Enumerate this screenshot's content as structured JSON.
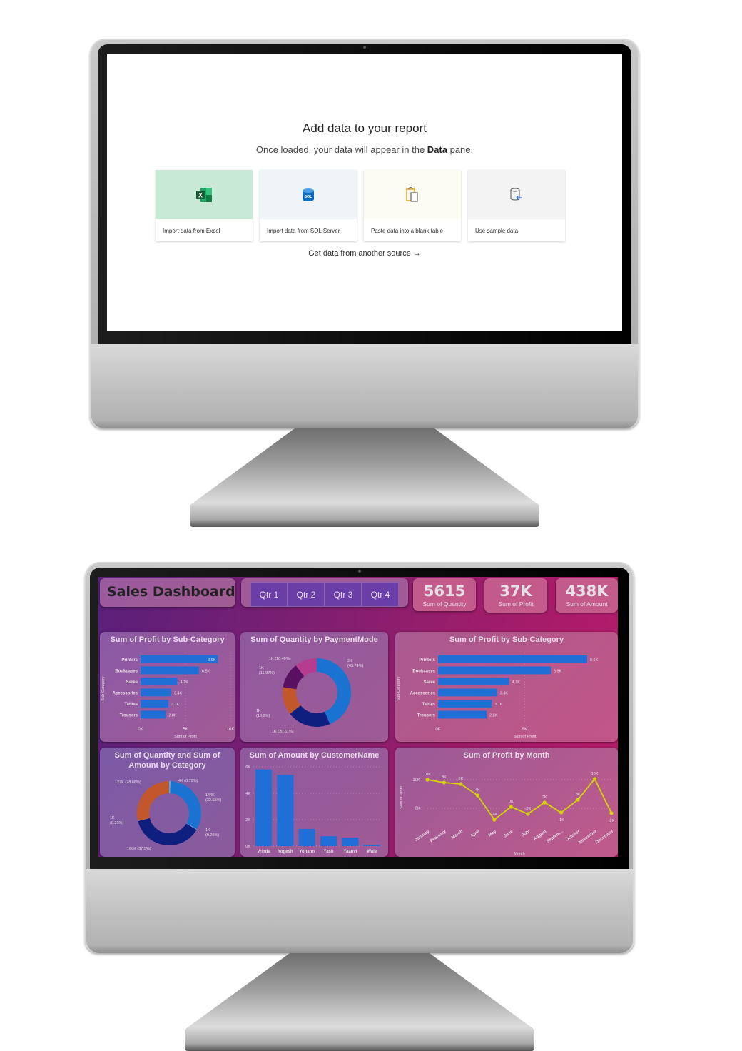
{
  "add_data": {
    "title": "Add data to your report",
    "subtitle_pre": "Once loaded, your data will appear in the ",
    "subtitle_bold": "Data",
    "subtitle_post": " pane.",
    "cards": [
      {
        "label": "Import data from Excel",
        "icon": "excel-icon",
        "bg": "#c7e9d6"
      },
      {
        "label": "Import data from SQL Server",
        "icon": "sql-database-icon",
        "bg": "#eff4f9"
      },
      {
        "label": "Paste data into a blank table",
        "icon": "clipboard-paste-icon",
        "bg": "#fcfbf4"
      },
      {
        "label": "Use sample data",
        "icon": "sample-database-icon",
        "bg": "#f3f3f3"
      }
    ],
    "more_link": "Get data from another source →"
  },
  "dashboard": {
    "title": "Sales Dashboard",
    "quarters": [
      "Qtr 1",
      "Qtr 2",
      "Qtr 3",
      "Qtr 4"
    ],
    "kpis": [
      {
        "value": "5615",
        "label": "Sum of Quantity"
      },
      {
        "value": "37K",
        "label": "Sum of Profit"
      },
      {
        "value": "438K",
        "label": "Sum of Amount"
      }
    ],
    "colors": {
      "bar": "#1f6fd6",
      "line": "#d4d400",
      "axis_text": "#e8dde8"
    }
  },
  "chart_data": [
    {
      "id": "profit_subcat_small",
      "type": "bar",
      "orientation": "horizontal",
      "title": "Sum of Profit by Sub-Category",
      "xlabel": "Sum of Profit",
      "ylabel": "Sub-Category",
      "categories": [
        "Printers",
        "Bookcases",
        "Saree",
        "Accessories",
        "Tables",
        "Trousers"
      ],
      "values": [
        8600,
        6500,
        4100,
        3400,
        3100,
        2800
      ],
      "data_labels": [
        "8.6K",
        "6.5K",
        "4.1K",
        "3.4K",
        "3.1K",
        "2.8K"
      ],
      "xticks": [
        "0K",
        "5K",
        "10K"
      ],
      "xlim": [
        0,
        10000
      ]
    },
    {
      "id": "qty_paymentmode",
      "type": "pie",
      "donut": true,
      "title": "Sum of Quantity by PaymentMode",
      "slices": [
        {
          "label": "2K (43.74%)",
          "value": 43.74,
          "color": "#1a73d1"
        },
        {
          "label": "1K (20.61%)",
          "value": 20.61,
          "color": "#0f1f80"
        },
        {
          "label": "1K (13.2%)",
          "value": 13.2,
          "color": "#c1572b"
        },
        {
          "label": "1K (11.97%)",
          "value": 11.97,
          "color": "#5a1060"
        },
        {
          "label": "1K (10.49%)",
          "value": 10.49,
          "color": "#b63c8f"
        }
      ]
    },
    {
      "id": "profit_subcat_large",
      "type": "bar",
      "orientation": "horizontal",
      "title": "Sum of Profit by Sub-Category",
      "xlabel": "Sum of Profit",
      "ylabel": "Sub-Category",
      "categories": [
        "Printers",
        "Bookcases",
        "Saree",
        "Accessories",
        "Tables",
        "Trousers"
      ],
      "values": [
        8600,
        6500,
        4100,
        3400,
        3100,
        2800
      ],
      "data_labels": [
        "8.6K",
        "6.5K",
        "4.1K",
        "3.4K",
        "3.1K",
        "2.8K"
      ],
      "xticks": [
        "0K",
        "5K"
      ],
      "xlim": [
        0,
        10000
      ]
    },
    {
      "id": "qty_amount_category",
      "type": "pie",
      "donut": true,
      "title": "Sum of Quantity and Sum of Amount by Category",
      "slices": [
        {
          "label": "4K (0.79%)",
          "value": 0.79,
          "color": "#5fa3e6"
        },
        {
          "label": "144K (32.55%)",
          "value": 32.55,
          "color": "#1a73d1"
        },
        {
          "label": "1K (0.26%)",
          "value": 0.26,
          "color": "#9bc0ea"
        },
        {
          "label": "166K (37.5%)",
          "value": 37.5,
          "color": "#0f1f80"
        },
        {
          "label": "1K (0.21%)",
          "value": 0.21,
          "color": "#e0a070"
        },
        {
          "label": "127K (28.68%)",
          "value": 28.68,
          "color": "#c1572b"
        }
      ]
    },
    {
      "id": "amount_customer",
      "type": "bar",
      "orientation": "vertical",
      "title": "Sum of Amount by CustomerName",
      "categories": [
        "Vrinda",
        "Yogesh",
        "Yohann",
        "Yash",
        "Yaanvi",
        "Wale"
      ],
      "values": [
        5800,
        5400,
        1300,
        750,
        650,
        100
      ],
      "yticks": [
        "0K",
        "2K",
        "4K",
        "6K"
      ],
      "ylim": [
        0,
        6000
      ]
    },
    {
      "id": "profit_month",
      "type": "line",
      "title": "Sum of Profit by Month",
      "xlabel": "Month",
      "ylabel": "Sum of Profit",
      "categories": [
        "January",
        "February",
        "March",
        "April",
        "May",
        "June",
        "July",
        "August",
        "Septem...",
        "October",
        "November",
        "December"
      ],
      "values": [
        10000,
        9000,
        8500,
        4500,
        -4000,
        500,
        -2000,
        2000,
        -1500,
        3000,
        10300,
        -1700
      ],
      "data_labels": [
        "10K",
        "8K",
        "8K",
        "4K",
        "-4K",
        "0K",
        "-2K",
        "2K",
        "-1K",
        "3K",
        "10K",
        "-2K"
      ],
      "yticks": [
        "0K",
        "10K"
      ],
      "ylim": [
        -5000,
        13000
      ]
    }
  ]
}
